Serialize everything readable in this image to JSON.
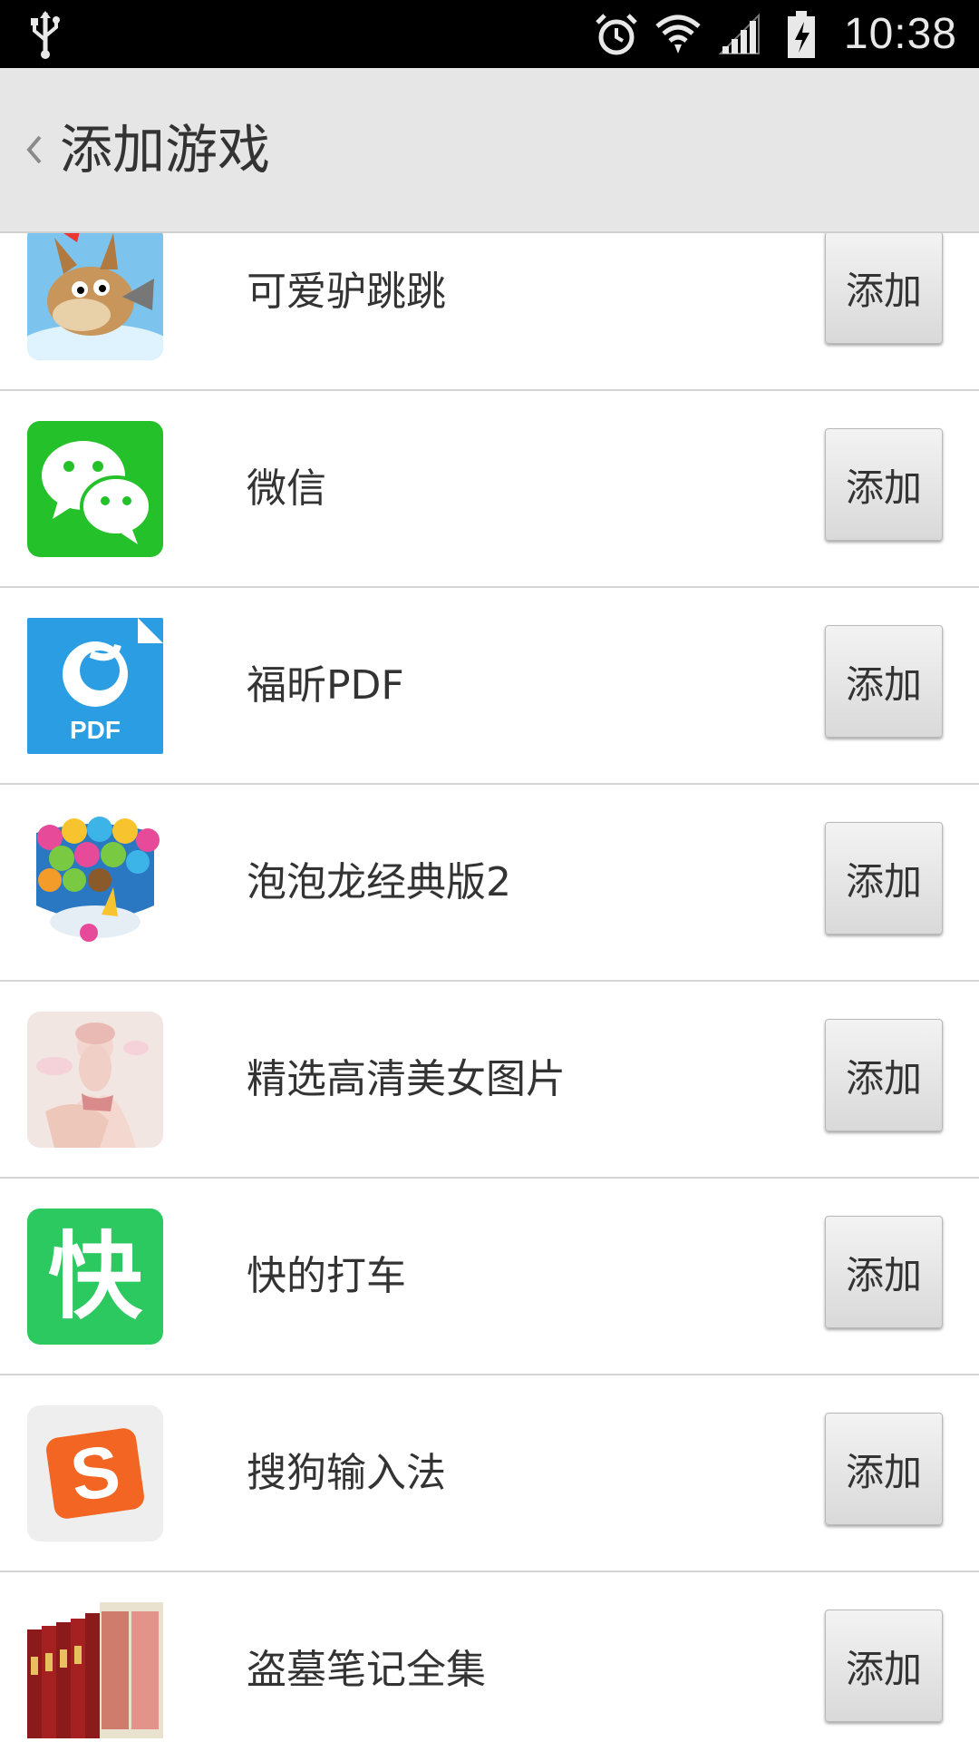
{
  "status_bar": {
    "time": "10:38"
  },
  "action_bar": {
    "title": "添加游戏",
    "back_icon": "chevron-left-icon"
  },
  "apps": [
    {
      "name": "可爱驴跳跳",
      "button": "添加",
      "icon": "donkey-game-icon"
    },
    {
      "name": "微信",
      "button": "添加",
      "icon": "wechat-icon"
    },
    {
      "name": "福昕PDF",
      "button": "添加",
      "icon": "foxit-pdf-icon",
      "icon_text": "PDF"
    },
    {
      "name": "泡泡龙经典版2",
      "button": "添加",
      "icon": "bubble-dragon-icon"
    },
    {
      "name": "精选高清美女图片",
      "button": "添加",
      "icon": "photo-gallery-icon"
    },
    {
      "name": "快的打车",
      "button": "添加",
      "icon": "kuaidi-taxi-icon",
      "icon_text": "快"
    },
    {
      "name": "搜狗输入法",
      "button": "添加",
      "icon": "sogou-input-icon",
      "icon_text": "S"
    },
    {
      "name": "盗墓笔记全集",
      "button": "添加",
      "icon": "book-collection-icon"
    }
  ],
  "colors": {
    "wechat_green": "#25c12a",
    "foxit_blue": "#2a9de3",
    "kuaidi_green": "#2cc860",
    "sogou_orange": "#f26522"
  }
}
